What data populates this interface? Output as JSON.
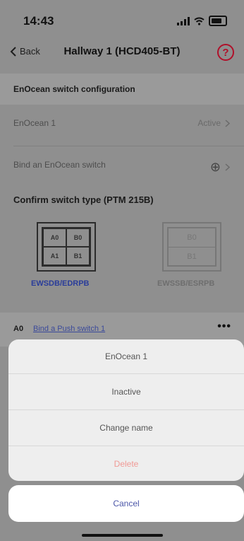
{
  "status_bar": {
    "time": "14:43"
  },
  "nav": {
    "back_label": "Back",
    "title": "Hallway 1 (HCD405-BT)",
    "help_symbol": "?"
  },
  "section_enocean": {
    "title": "EnOcean switch configuration"
  },
  "rows": [
    {
      "label": "EnOcean 1",
      "value": "Active"
    },
    {
      "label": "Bind an EnOcean switch",
      "value": "⊕"
    }
  ],
  "confirm": {
    "title": "Confirm switch type (PTM 215B)",
    "left": {
      "cells": [
        "A0",
        "B0",
        "A1",
        "B1"
      ],
      "label": "EWSDB/EDRPB",
      "label_color": "#2a3d9a"
    },
    "right": {
      "cells": [
        "B0",
        "B1"
      ],
      "label": "EWSSB/ESRPB",
      "label_color": "#6e6e6e"
    }
  },
  "a0_row": {
    "tag": "A0",
    "link": "Bind a Push switch 1",
    "more": "•••"
  },
  "sheet": {
    "title": "EnOcean 1",
    "items": [
      "Inactive",
      "Change name",
      "Delete"
    ],
    "cancel": "Cancel"
  }
}
